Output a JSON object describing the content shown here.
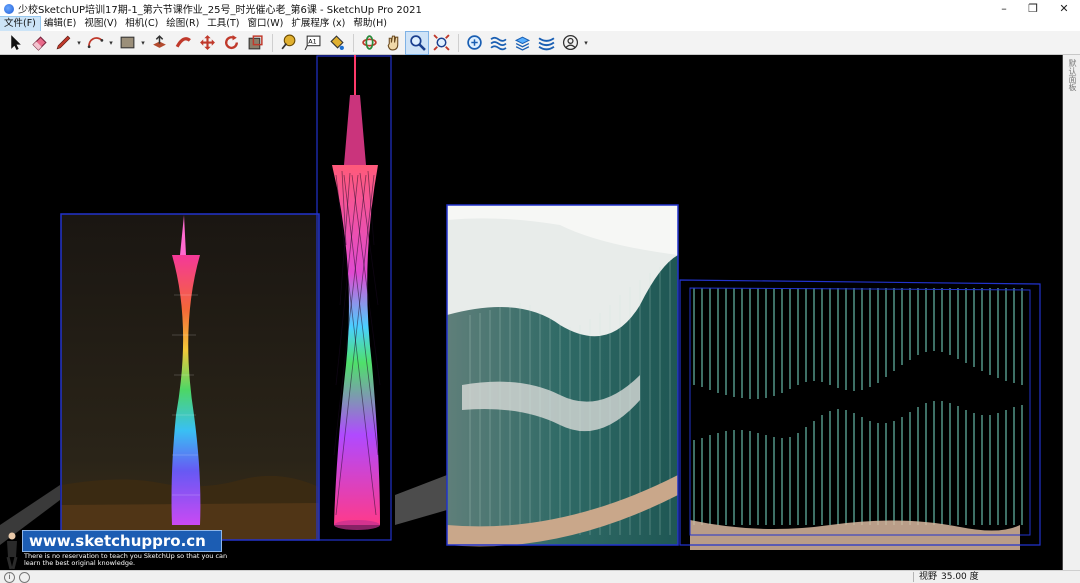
{
  "window": {
    "title": "少校SketchUP培训17期-1_第六节课作业_25号_时光催心老_第6课 - SketchUp Pro 2021",
    "minimize_glyph": "–",
    "maximize_glyph": "❐",
    "close_glyph": "✕"
  },
  "menu": {
    "items": [
      "文件(F)",
      "编辑(E)",
      "视图(V)",
      "相机(C)",
      "绘图(R)",
      "工具(T)",
      "窗口(W)",
      "扩展程序 (x)",
      "帮助(H)"
    ]
  },
  "toolbar": {
    "tools": [
      {
        "name": "select-tool",
        "icon": "arrow-cursor-icon"
      },
      {
        "name": "eraser-tool",
        "icon": "eraser-icon"
      },
      {
        "name": "line-tool",
        "icon": "pencil-icon"
      },
      {
        "name": "arc-tool",
        "icon": "arc-icon"
      },
      {
        "name": "shape-tool",
        "icon": "rectangle-icon"
      },
      {
        "name": "push-pull-tool",
        "icon": "push-pull-icon"
      },
      {
        "name": "follow-me-tool",
        "icon": "follow-me-icon"
      },
      {
        "name": "move-tool",
        "icon": "move-icon"
      },
      {
        "name": "rotate-tool",
        "icon": "rotate-icon"
      },
      {
        "name": "scale-tool",
        "icon": "scale-icon"
      },
      {
        "name": "tape-measure-tool",
        "icon": "tape-measure-icon"
      },
      {
        "name": "text-tool",
        "icon": "text-label-icon"
      },
      {
        "name": "paint-bucket-tool",
        "icon": "paint-bucket-icon"
      },
      {
        "name": "orbit-tool",
        "icon": "orbit-icon"
      },
      {
        "name": "pan-tool",
        "icon": "hand-icon"
      },
      {
        "name": "zoom-tool",
        "icon": "magnifier-icon"
      },
      {
        "name": "zoom-extents-tool",
        "icon": "zoom-extents-icon"
      },
      {
        "name": "warehouse-tool",
        "icon": "3d-warehouse-icon"
      },
      {
        "name": "extension-tool-1",
        "icon": "extension-waves-icon"
      },
      {
        "name": "extension-tool-2",
        "icon": "extension-layers-icon"
      },
      {
        "name": "extension-tool-3",
        "icon": "extension-ribbon-icon"
      },
      {
        "name": "account-tool",
        "icon": "user-icon"
      }
    ],
    "text_tool_label": "A1"
  },
  "side_panel": {
    "label": "默认面板"
  },
  "watermark": {
    "url": "www.sketchuppro.cn",
    "tagline": "There is no reservation to teach you SketchUp so that you can learn the best original knowledge."
  },
  "status": {
    "vcb_label": "视野",
    "vcb_value": "35.00 度",
    "geo_glyph": "i"
  },
  "colors": {
    "viewport_bg": "#000000",
    "selection_box": "#2233cc",
    "accent": "#1c5db3",
    "tower_mesh": "#c03090",
    "wave_strings": "#7fe3cf"
  }
}
